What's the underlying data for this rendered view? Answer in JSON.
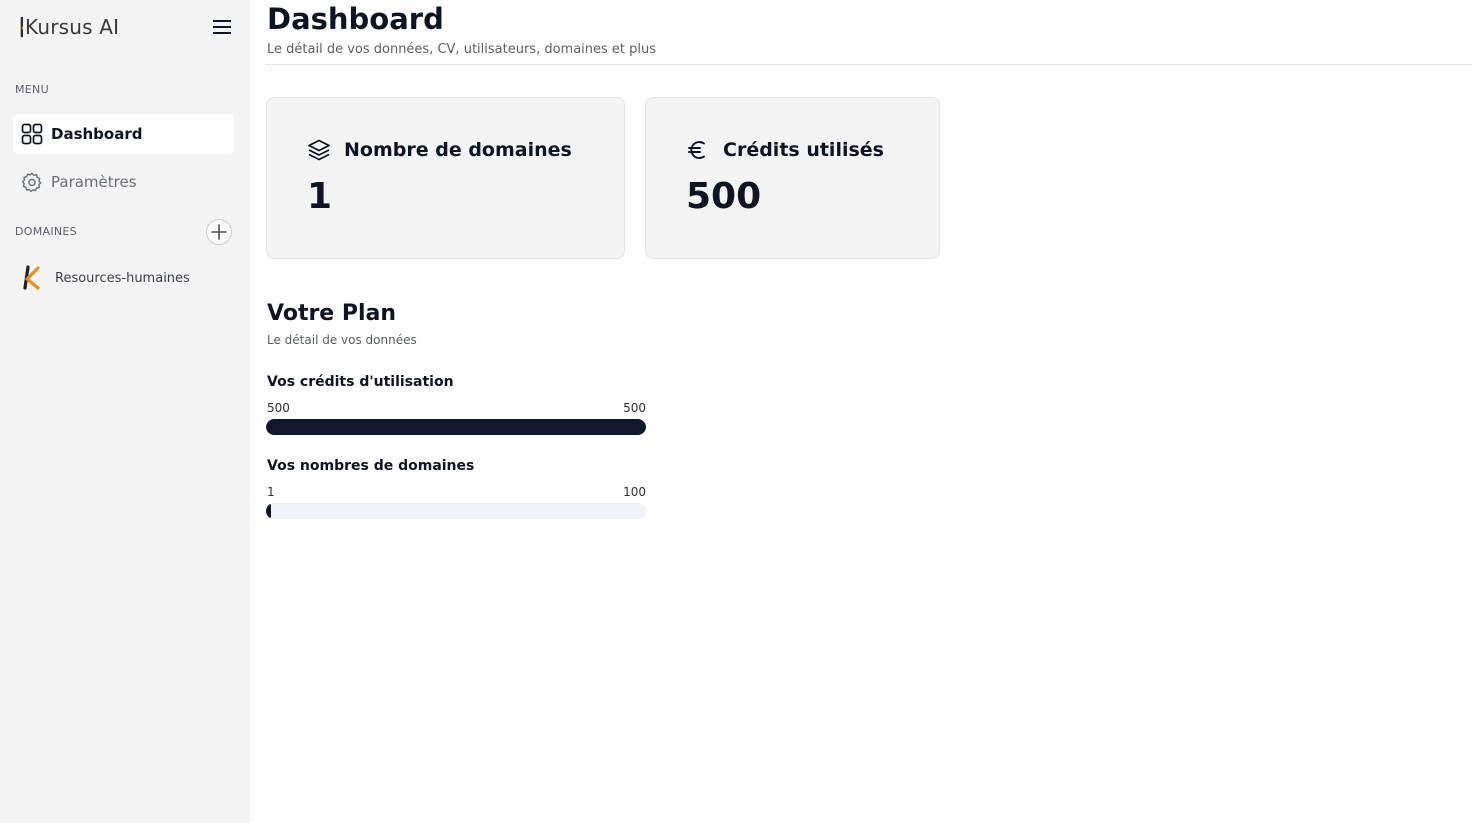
{
  "brand": {
    "name": "Kursus AI",
    "logo_letter": "K"
  },
  "sidebar": {
    "menu_label": "MENU",
    "items": [
      {
        "label": "Dashboard",
        "icon": "grid-icon",
        "active": true
      },
      {
        "label": "Paramètres",
        "icon": "gear-icon",
        "active": false
      }
    ],
    "domains_label": "DOMAINES",
    "domains": [
      {
        "label": "Resources-humaines",
        "icon": "kursus-k-logo"
      }
    ]
  },
  "header": {
    "title": "Dashboard",
    "subtitle": "Le détail de vos données, CV, utilisateurs, domaines et plus"
  },
  "cards": [
    {
      "title": "Nombre de domaines",
      "value": "1",
      "icon": "layers-icon"
    },
    {
      "title": "Crédits utilisés",
      "value": "500",
      "icon": "euro-icon"
    }
  ],
  "plan": {
    "title": "Votre Plan",
    "subtitle": "Le détail de vos données",
    "meters": [
      {
        "label": "Vos crédits d'utilisation",
        "current": "500",
        "max": "500",
        "fraction": 1.0
      },
      {
        "label": "Vos nombres de domaines",
        "current": "1",
        "max": "100",
        "fraction": 0.01
      }
    ]
  },
  "colors": {
    "accent_orange": "#f08a1c",
    "dark": "#0f172a",
    "sidebar_bg": "#f4f4f5"
  }
}
